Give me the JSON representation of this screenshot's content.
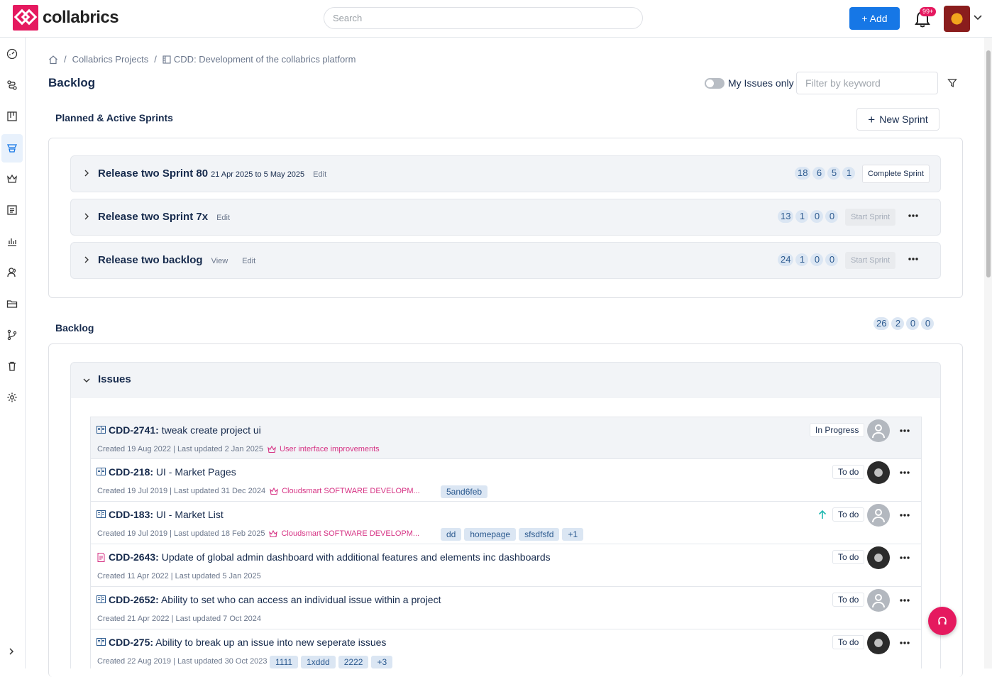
{
  "app": {
    "brand": "collabrics",
    "accent": "#e5195f",
    "primary": "#1677e6"
  },
  "header": {
    "search_placeholder": "Search",
    "add_label": "+ Add",
    "notification_count": "99+"
  },
  "sidebar": {
    "items": [
      {
        "name": "dashboard-icon"
      },
      {
        "name": "workflow-icon"
      },
      {
        "name": "board-icon"
      },
      {
        "name": "backlog-icon",
        "active": true
      },
      {
        "name": "epics-icon"
      },
      {
        "name": "list-icon"
      },
      {
        "name": "reports-icon"
      },
      {
        "name": "people-icon"
      },
      {
        "name": "folder-icon"
      },
      {
        "name": "branch-icon"
      },
      {
        "name": "trash-icon"
      },
      {
        "name": "settings-icon"
      }
    ]
  },
  "breadcrumb": {
    "items": [
      "Collabrics Projects",
      "CDD: Development of the collabrics platform"
    ]
  },
  "page": {
    "title": "Backlog",
    "my_issues_label": "My Issues only",
    "filter_placeholder": "Filter by keyword"
  },
  "sprints_section": {
    "title": "Planned & Active Sprints",
    "new_sprint_label": "New Sprint",
    "sprints": [
      {
        "name": "Release two Sprint 80",
        "dates": "21 Apr 2025 to 5 May 2025",
        "links": [
          "Edit"
        ],
        "counts": [
          "18",
          "6",
          "5",
          "1"
        ],
        "action": "Complete Sprint"
      },
      {
        "name": "Release two Sprint 7x",
        "dates": "",
        "links": [
          "Edit"
        ],
        "counts": [
          "13",
          "1",
          "0",
          "0"
        ],
        "action": "Start Sprint"
      },
      {
        "name": "Release two backlog",
        "dates": "",
        "links": [
          "View",
          "Edit"
        ],
        "counts": [
          "24",
          "1",
          "0",
          "0"
        ],
        "action": "Start Sprint"
      }
    ]
  },
  "backlog_section": {
    "title": "Backlog",
    "counts": [
      "26",
      "2",
      "0",
      "0"
    ],
    "group_title": "Issues",
    "issues": [
      {
        "key": "CDD-2741:",
        "title": "tweak create project ui",
        "meta": "Created 19 Aug 2022 | Last updated 2 Jan 2025",
        "epic": "User interface improvements",
        "tags": [],
        "status": "In Progress",
        "avatar": "blank",
        "type": "story"
      },
      {
        "key": "CDD-218:",
        "title": "UI - Market Pages",
        "meta": "Created 19 Jul 2019 | Last updated 31 Dec 2024",
        "epic": "Cloudsmart SOFTWARE DEVELOPM...",
        "tags": [
          "5and6feb"
        ],
        "status": "To do",
        "avatar": "photo",
        "type": "story"
      },
      {
        "key": "CDD-183:",
        "title": "UI - Market List",
        "meta": "Created 19 Jul 2019 | Last updated 18 Feb 2025",
        "epic": "Cloudsmart SOFTWARE DEVELOPM...",
        "tags": [
          "dd",
          "homepage",
          "sfsdfsfd",
          "+1"
        ],
        "status": "To do",
        "avatar": "blank",
        "type": "story",
        "priority": "up"
      },
      {
        "key": "CDD-2643:",
        "title": "Update of global admin dashboard with additional features and elements inc dashboards",
        "meta": "Created 11 Apr 2022 | Last updated 5 Jan 2025",
        "epic": "",
        "tags": [],
        "status": "To do",
        "avatar": "photo",
        "type": "task"
      },
      {
        "key": "CDD-2652:",
        "title": "Ability to set who can access an individual issue within a project",
        "meta": "Created 21 Apr 2022 | Last updated 7 Oct 2024",
        "epic": "",
        "tags": [],
        "status": "To do",
        "avatar": "blank",
        "type": "story"
      },
      {
        "key": "CDD-275:",
        "title": "Ability to break up an issue into new seperate issues",
        "meta": "Created 22 Aug 2019 | Last updated 30 Oct 2023",
        "epic": "",
        "tags": [
          "1111",
          "1xddd",
          "2222",
          "+3"
        ],
        "status": "To do",
        "avatar": "photo",
        "type": "story"
      }
    ]
  }
}
